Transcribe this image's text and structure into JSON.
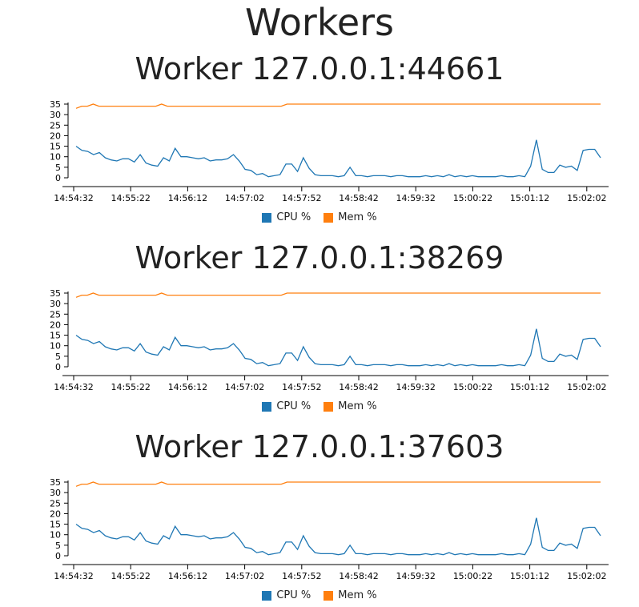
{
  "page": {
    "title": "Workers"
  },
  "colors": {
    "cpu": "#1f77b4",
    "mem": "#ff7f0e"
  },
  "workers": [
    {
      "title": "Worker 127.0.0.1:44661"
    },
    {
      "title": "Worker 127.0.0.1:38269"
    },
    {
      "title": "Worker 127.0.0.1:37603"
    }
  ],
  "chart_data": [
    {
      "type": "line",
      "title": "Worker 127.0.0.1:44661",
      "x_tick_labels": [
        "14:54:32",
        "14:55:22",
        "14:56:12",
        "14:57:02",
        "14:57:52",
        "14:58:42",
        "14:59:32",
        "15:00:22",
        "15:01:12",
        "15:02:02"
      ],
      "y_ticks": [
        0,
        5,
        10,
        15,
        20,
        25,
        30,
        35
      ],
      "ylim": [
        0,
        35
      ],
      "legend_position": "bottom",
      "series": [
        {
          "name": "CPU %",
          "values": [
            15,
            13,
            12.5,
            11,
            12,
            9.5,
            8.5,
            8,
            9,
            9,
            7.5,
            11,
            7,
            6,
            5.5,
            9.5,
            8,
            14,
            10,
            10,
            9.5,
            9,
            9.5,
            8,
            8.5,
            8.5,
            9,
            11,
            8,
            4,
            3.5,
            1.5,
            2,
            0.5,
            1,
            1.5,
            6.5,
            6.5,
            3,
            9.5,
            4.5,
            1.5,
            1,
            1,
            1,
            0.5,
            1,
            5,
            1,
            1,
            0.5,
            1,
            1,
            1,
            0.5,
            1,
            1,
            0.5,
            0.5,
            0.5,
            1,
            0.5,
            1,
            0.5,
            1.5,
            0.5,
            1,
            0.5,
            1,
            0.5,
            0.5,
            0.5,
            0.5,
            1,
            0.5,
            0.5,
            1,
            0.5,
            5.5,
            18,
            4,
            2.5,
            2.5,
            6,
            5,
            5.5,
            3.5,
            13,
            13.5,
            13.5,
            9.5
          ]
        },
        {
          "name": "Mem %",
          "values": [
            33,
            34,
            34,
            35,
            34,
            34,
            34,
            34,
            34,
            34,
            34,
            34,
            34,
            34,
            34,
            35,
            34,
            34,
            34,
            34,
            34,
            34,
            34,
            34,
            34,
            34,
            34,
            34,
            34,
            34,
            34,
            34,
            34,
            34,
            34,
            34,
            34,
            35,
            35,
            35,
            35,
            35,
            35,
            35,
            35,
            35,
            35,
            35,
            35,
            35,
            35,
            35,
            35,
            35,
            35,
            35,
            35,
            35,
            35,
            35,
            35,
            35,
            35,
            35,
            35,
            35,
            35,
            35,
            35,
            35,
            35,
            35,
            35,
            35,
            35,
            35,
            35,
            35,
            35,
            35,
            35,
            35,
            35,
            35,
            35,
            35,
            35,
            35,
            35,
            35,
            35,
            35,
            35
          ]
        }
      ]
    },
    {
      "type": "line",
      "title": "Worker 127.0.0.1:38269",
      "x_tick_labels": [
        "14:54:32",
        "14:55:22",
        "14:56:12",
        "14:57:02",
        "14:57:52",
        "14:58:42",
        "14:59:32",
        "15:00:22",
        "15:01:12",
        "15:02:02"
      ],
      "y_ticks": [
        0,
        5,
        10,
        15,
        20,
        25,
        30,
        35
      ],
      "ylim": [
        0,
        35
      ],
      "legend_position": "bottom",
      "series": [
        {
          "name": "CPU %",
          "values": [
            15,
            13,
            12.5,
            11,
            12,
            9.5,
            8.5,
            8,
            9,
            9,
            7.5,
            11,
            7,
            6,
            5.5,
            9.5,
            8,
            14,
            10,
            10,
            9.5,
            9,
            9.5,
            8,
            8.5,
            8.5,
            9,
            11,
            8,
            4,
            3.5,
            1.5,
            2,
            0.5,
            1,
            1.5,
            6.5,
            6.5,
            3,
            9.5,
            4.5,
            1.5,
            1,
            1,
            1,
            0.5,
            1,
            5,
            1,
            1,
            0.5,
            1,
            1,
            1,
            0.5,
            1,
            1,
            0.5,
            0.5,
            0.5,
            1,
            0.5,
            1,
            0.5,
            1.5,
            0.5,
            1,
            0.5,
            1,
            0.5,
            0.5,
            0.5,
            0.5,
            1,
            0.5,
            0.5,
            1,
            0.5,
            5.5,
            18,
            4,
            2.5,
            2.5,
            6,
            5,
            5.5,
            3.5,
            13,
            13.5,
            13.5,
            9.5
          ]
        },
        {
          "name": "Mem %",
          "values": [
            33,
            34,
            34,
            35,
            34,
            34,
            34,
            34,
            34,
            34,
            34,
            34,
            34,
            34,
            34,
            35,
            34,
            34,
            34,
            34,
            34,
            34,
            34,
            34,
            34,
            34,
            34,
            34,
            34,
            34,
            34,
            34,
            34,
            34,
            34,
            34,
            34,
            35,
            35,
            35,
            35,
            35,
            35,
            35,
            35,
            35,
            35,
            35,
            35,
            35,
            35,
            35,
            35,
            35,
            35,
            35,
            35,
            35,
            35,
            35,
            35,
            35,
            35,
            35,
            35,
            35,
            35,
            35,
            35,
            35,
            35,
            35,
            35,
            35,
            35,
            35,
            35,
            35,
            35,
            35,
            35,
            35,
            35,
            35,
            35,
            35,
            35,
            35,
            35,
            35,
            35,
            35,
            35
          ]
        }
      ]
    },
    {
      "type": "line",
      "title": "Worker 127.0.0.1:37603",
      "x_tick_labels": [
        "14:54:32",
        "14:55:22",
        "14:56:12",
        "14:57:02",
        "14:57:52",
        "14:58:42",
        "14:59:32",
        "15:00:22",
        "15:01:12",
        "15:02:02"
      ],
      "y_ticks": [
        0,
        5,
        10,
        15,
        20,
        25,
        30,
        35
      ],
      "ylim": [
        0,
        35
      ],
      "legend_position": "bottom",
      "series": [
        {
          "name": "CPU %",
          "values": [
            15,
            13,
            12.5,
            11,
            12,
            9.5,
            8.5,
            8,
            9,
            9,
            7.5,
            11,
            7,
            6,
            5.5,
            9.5,
            8,
            14,
            10,
            10,
            9.5,
            9,
            9.5,
            8,
            8.5,
            8.5,
            9,
            11,
            8,
            4,
            3.5,
            1.5,
            2,
            0.5,
            1,
            1.5,
            6.5,
            6.5,
            3,
            9.5,
            4.5,
            1.5,
            1,
            1,
            1,
            0.5,
            1,
            5,
            1,
            1,
            0.5,
            1,
            1,
            1,
            0.5,
            1,
            1,
            0.5,
            0.5,
            0.5,
            1,
            0.5,
            1,
            0.5,
            1.5,
            0.5,
            1,
            0.5,
            1,
            0.5,
            0.5,
            0.5,
            0.5,
            1,
            0.5,
            0.5,
            1,
            0.5,
            5.5,
            18,
            4,
            2.5,
            2.5,
            6,
            5,
            5.5,
            3.5,
            13,
            13.5,
            13.5,
            9.5
          ]
        },
        {
          "name": "Mem %",
          "values": [
            33,
            34,
            34,
            35,
            34,
            34,
            34,
            34,
            34,
            34,
            34,
            34,
            34,
            34,
            34,
            35,
            34,
            34,
            34,
            34,
            34,
            34,
            34,
            34,
            34,
            34,
            34,
            34,
            34,
            34,
            34,
            34,
            34,
            34,
            34,
            34,
            34,
            35,
            35,
            35,
            35,
            35,
            35,
            35,
            35,
            35,
            35,
            35,
            35,
            35,
            35,
            35,
            35,
            35,
            35,
            35,
            35,
            35,
            35,
            35,
            35,
            35,
            35,
            35,
            35,
            35,
            35,
            35,
            35,
            35,
            35,
            35,
            35,
            35,
            35,
            35,
            35,
            35,
            35,
            35,
            35,
            35,
            35,
            35,
            35,
            35,
            35,
            35,
            35,
            35,
            35,
            35,
            35
          ]
        }
      ]
    }
  ]
}
